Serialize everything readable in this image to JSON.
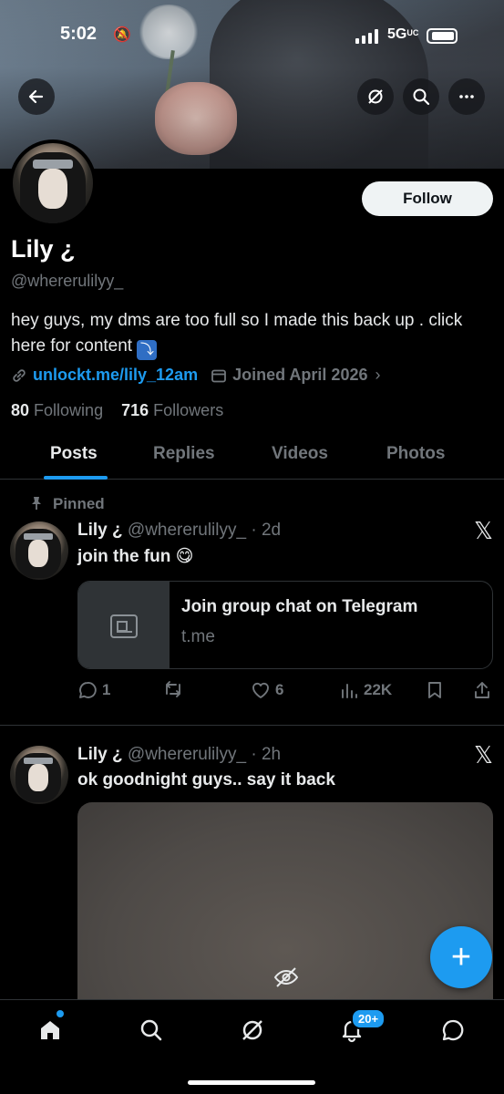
{
  "status_bar": {
    "time": "5:02",
    "network": "5G",
    "network_suffix": "UC"
  },
  "header": {
    "back_icon": "arrow-left-icon",
    "grok_icon": "grok-icon",
    "search_icon": "search-icon",
    "more_icon": "more-horizontal-icon"
  },
  "profile": {
    "display_name": "Lily ¿",
    "handle": "@whererulilyy_",
    "follow_label": "Follow",
    "bio": "hey guys, my dms are too full so I made this back up . click here for content",
    "bio_emoji": "⤵",
    "link": "unlockt.me/lily_12am",
    "joined": "Joined April 2026",
    "following_count": "80",
    "following_label": "Following",
    "followers_count": "716",
    "followers_label": "Followers"
  },
  "tabs": [
    {
      "label": "Posts",
      "active": true
    },
    {
      "label": "Replies",
      "active": false
    },
    {
      "label": "Videos",
      "active": false
    },
    {
      "label": "Photos",
      "active": false
    }
  ],
  "posts": [
    {
      "pinned_label": "Pinned",
      "name": "Lily ¿",
      "handle_time": "@whererulilyy_ · 2d",
      "text": "join the fun 😋",
      "card": {
        "title": "Join group chat on Telegram",
        "domain": "t.me"
      },
      "replies": "1",
      "retweets": "",
      "likes": "6",
      "views": "22K"
    },
    {
      "name": "Lily ¿",
      "handle_time": "@whererulilyy_ · 2h",
      "text": "ok goodnight guys.. say it back"
    }
  ],
  "fab_label": "+",
  "bottom_nav": {
    "notifications_badge": "20+"
  },
  "colors": {
    "accent": "#1d9bf0",
    "background": "#000000",
    "muted": "#71767b",
    "text": "#e7e9ea"
  }
}
